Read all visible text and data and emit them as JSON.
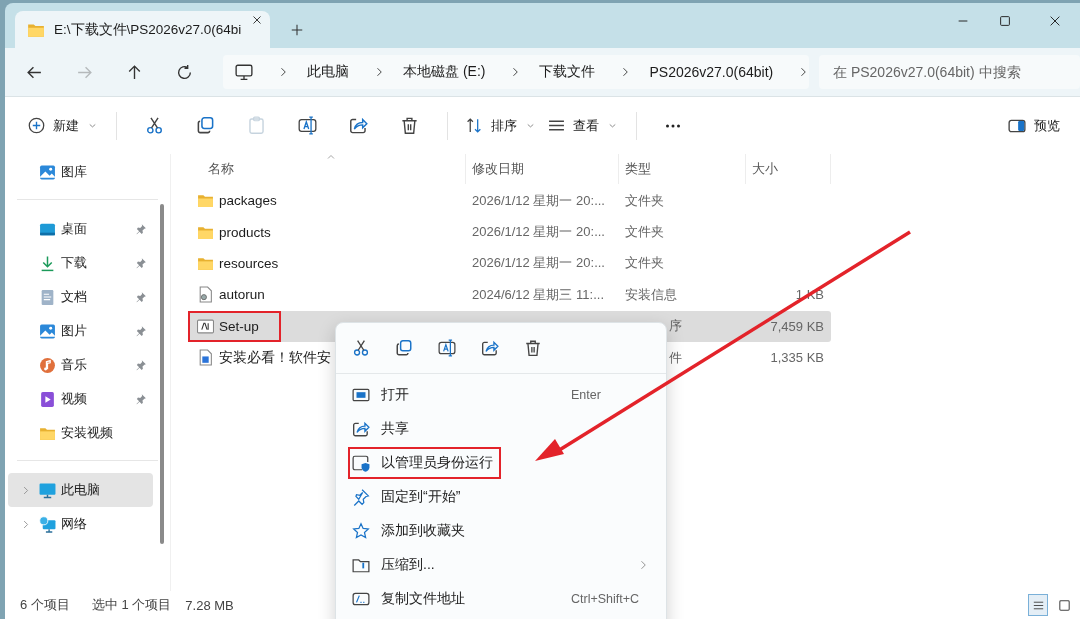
{
  "window": {
    "tab": {
      "title": "E:\\下载文件\\PS2026v27.0(64bi",
      "selected": true
    }
  },
  "nav": [
    {
      "kind": "back",
      "disabled": false
    },
    {
      "kind": "forward",
      "disabled": true
    },
    {
      "kind": "up",
      "disabled": false
    },
    {
      "kind": "refresh",
      "disabled": false
    }
  ],
  "breadcrumb": [
    "此电脑",
    "本地磁盘 (E:)",
    "下载文件",
    "PS2026v27.0(64bit)"
  ],
  "search": {
    "placeholder": "在 PS2026v27.0(64bit) 中搜索"
  },
  "toolbar": [
    {
      "kind": "new",
      "label": "新建",
      "dropdown": true,
      "disabled": false
    },
    {
      "kind": "cut",
      "disabled": false
    },
    {
      "kind": "copy",
      "disabled": false
    },
    {
      "kind": "paste",
      "disabled": true
    },
    {
      "kind": "rename",
      "disabled": false
    },
    {
      "kind": "share",
      "disabled": false
    },
    {
      "kind": "delete",
      "disabled": false
    },
    {
      "kind": "sort",
      "label": "排序",
      "dropdown": true,
      "disabled": false
    },
    {
      "kind": "view",
      "label": "查看",
      "dropdown": true,
      "disabled": false
    },
    {
      "kind": "more",
      "disabled": false
    }
  ],
  "preview": {
    "label": "预览"
  },
  "sidebar": {
    "sections": [
      {
        "items": [
          {
            "kind": "gallery",
            "label": "图库",
            "pinned": false,
            "selected": false,
            "expandable": false
          }
        ]
      },
      {
        "items": [
          {
            "kind": "desktop",
            "label": "桌面",
            "pinned": true,
            "selected": false,
            "expandable": false
          },
          {
            "kind": "downloads",
            "label": "下载",
            "pinned": true,
            "selected": false,
            "expandable": false
          },
          {
            "kind": "documents",
            "label": "文档",
            "pinned": true,
            "selected": false,
            "expandable": false
          },
          {
            "kind": "pictures",
            "label": "图片",
            "pinned": true,
            "selected": false,
            "expandable": false
          },
          {
            "kind": "music",
            "label": "音乐",
            "pinned": true,
            "selected": false,
            "expandable": false
          },
          {
            "kind": "videos",
            "label": "视频",
            "pinned": true,
            "selected": false,
            "expandable": false
          },
          {
            "kind": "folder",
            "label": "安装视频",
            "pinned": false,
            "selected": false,
            "expandable": false
          }
        ]
      },
      {
        "items": [
          {
            "kind": "pc",
            "label": "此电脑",
            "pinned": false,
            "selected": true,
            "expandable": true
          },
          {
            "kind": "network",
            "label": "网络",
            "pinned": false,
            "selected": false,
            "expandable": true
          }
        ]
      }
    ]
  },
  "table": {
    "columns": [
      "名称",
      "修改日期",
      "类型",
      "大小"
    ],
    "rows": [
      {
        "kind": "folder",
        "name": "packages",
        "date": "2026/1/12 星期一 20:...",
        "type": "文件夹",
        "selected": false,
        "highlighted": false
      },
      {
        "kind": "folder",
        "name": "products",
        "date": "2026/1/12 星期一 20:...",
        "type": "文件夹",
        "selected": false,
        "highlighted": false
      },
      {
        "kind": "folder",
        "name": "resources",
        "date": "2026/1/12 星期一 20:...",
        "type": "文件夹",
        "selected": false,
        "highlighted": false
      },
      {
        "kind": "setup-info",
        "name": "autorun",
        "date": "2024/6/12 星期三 11:...",
        "type": "安装信息",
        "size": "1 KB",
        "selected": false,
        "highlighted": false
      },
      {
        "kind": "app",
        "name": "Set-up",
        "type": "序",
        "size": "7,459 KB",
        "selected": true,
        "highlighted": true
      },
      {
        "kind": "document",
        "name": "安装必看！软件安",
        "type": "件",
        "size": "1,335 KB",
        "selected": false,
        "highlighted": false
      }
    ]
  },
  "context_menu": {
    "actions": [
      {
        "kind": "cut"
      },
      {
        "kind": "copy"
      },
      {
        "kind": "rename"
      },
      {
        "kind": "share"
      },
      {
        "kind": "delete"
      }
    ],
    "items": [
      {
        "kind": "open",
        "label": "打开",
        "shortcut": "Enter",
        "submenu": false,
        "highlighted": false
      },
      {
        "kind": "share",
        "label": "共享",
        "submenu": false,
        "highlighted": false
      },
      {
        "kind": "admin",
        "label": "以管理员身份运行",
        "submenu": false,
        "highlighted": true
      },
      {
        "kind": "pin",
        "label": "固定到“开始”",
        "submenu": false,
        "highlighted": false
      },
      {
        "kind": "star",
        "label": "添加到收藏夹",
        "submenu": false,
        "highlighted": false
      },
      {
        "kind": "compress",
        "label": "压缩到...",
        "submenu": true,
        "highlighted": false
      },
      {
        "kind": "copy-path",
        "label": "复制文件地址",
        "shortcut": "Ctrl+Shift+C",
        "submenu": false,
        "highlighted": false
      }
    ]
  },
  "status_bar": {
    "count": "6 个项目",
    "selection": "选中 1 个项目",
    "size": "7.28 MB"
  },
  "view_buttons": [
    {
      "kind": "details",
      "selected": true
    },
    {
      "kind": "tiles",
      "selected": false
    }
  ],
  "annotation": {
    "arrow": true
  }
}
